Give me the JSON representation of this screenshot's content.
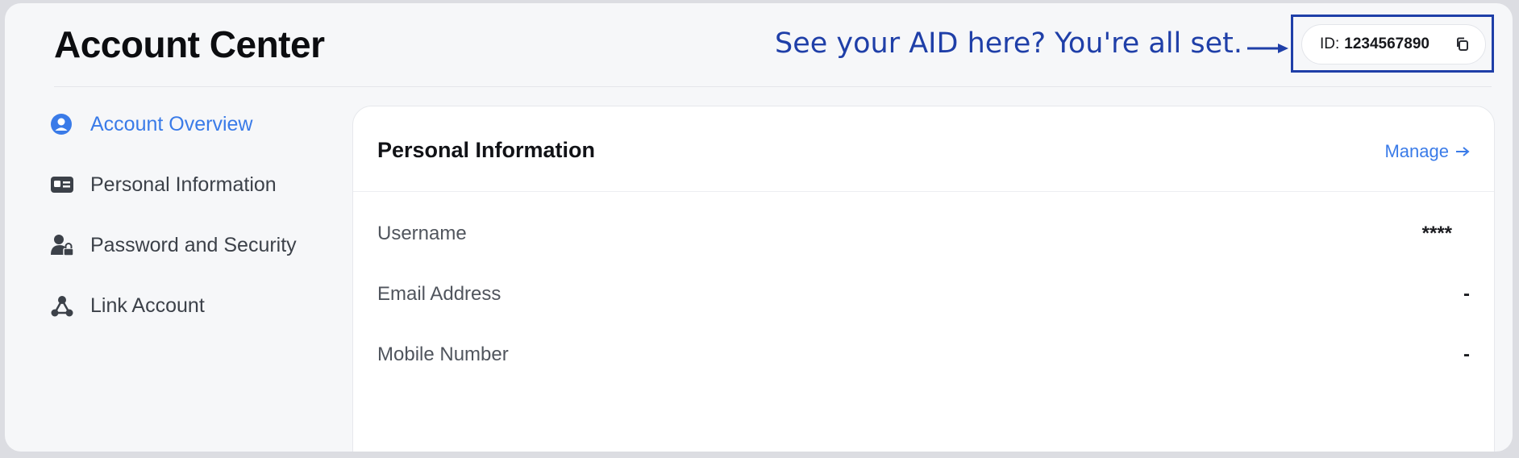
{
  "page": {
    "title": "Account Center"
  },
  "annotation": {
    "text": "See your AID here?  You're all set.",
    "color": "#1f3fa8"
  },
  "account_id": {
    "label": "ID:",
    "value": "1234567890",
    "copy_icon": "copy-icon"
  },
  "sidebar": {
    "items": [
      {
        "label": "Account Overview",
        "icon": "user-circle-icon",
        "active": true
      },
      {
        "label": "Personal Information",
        "icon": "id-card-icon",
        "active": false
      },
      {
        "label": "Password and Security",
        "icon": "user-lock-icon",
        "active": false
      },
      {
        "label": "Link Account",
        "icon": "link-nodes-icon",
        "active": false
      }
    ]
  },
  "card": {
    "title": "Personal Information",
    "manage_label": "Manage",
    "rows": [
      {
        "label": "Username",
        "value": "****"
      },
      {
        "label": "Email Address",
        "value": "-"
      },
      {
        "label": "Mobile Number",
        "value": "-"
      }
    ]
  },
  "colors": {
    "accent": "#3a7be8",
    "background": "#f6f7f9",
    "text": "#111216"
  }
}
